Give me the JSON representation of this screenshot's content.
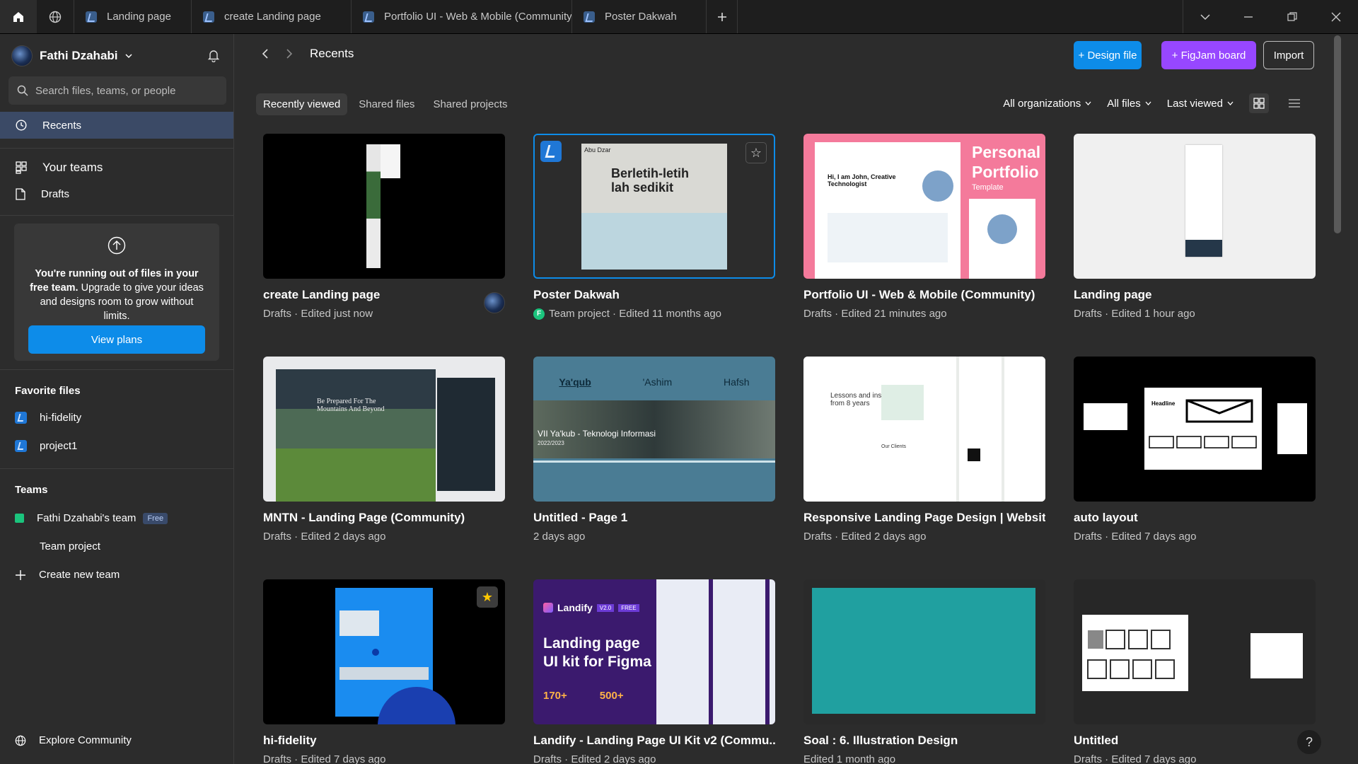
{
  "tabs": [
    {
      "label": "Landing page"
    },
    {
      "label": "create Landing page"
    },
    {
      "label": "Portfolio UI - Web & Mobile (Community)"
    },
    {
      "label": "Poster Dakwah"
    }
  ],
  "sidebar": {
    "user_name": "Fathi Dzahabi",
    "search_placeholder": "Search files, teams, or people",
    "recents": "Recents",
    "your_teams": "Your teams",
    "drafts": "Drafts",
    "upgrade_text_bold": "You're running out of files in your free team.",
    "upgrade_text_rest": " Upgrade to give your ideas and designs room to grow without limits.",
    "view_plans": "View plans",
    "favorites_title": "Favorite files",
    "favorites": [
      "hi-fidelity",
      "project1"
    ],
    "teams_title": "Teams",
    "team_name": "Fathi Dzahabi's team",
    "team_badge": "Free",
    "team_project": "Team project",
    "create_team": "Create new team",
    "explore": "Explore Community"
  },
  "header": {
    "title": "Recents",
    "design_file": "+ Design file",
    "figjam_board": "+ FigJam board",
    "import": "Import"
  },
  "filters": {
    "tabs": [
      "Recently viewed",
      "Shared files",
      "Shared projects"
    ],
    "org": "All organizations",
    "files": "All files",
    "sort": "Last viewed"
  },
  "colors": {
    "accent_blue": "#0d8ce9",
    "figjam_purple": "#9747ff",
    "team_green": "#1bc47d"
  },
  "files": [
    {
      "title": "create Landing page",
      "sub": "Drafts · Edited just now"
    },
    {
      "title": "Poster Dakwah",
      "sub": "Team project · Edited 11 months ago",
      "project_initial": "F"
    },
    {
      "title": "Portfolio UI - Web & Mobile (Community)",
      "sub": "Drafts · Edited 21 minutes ago"
    },
    {
      "title": "Landing page",
      "sub": "Drafts · Edited 1 hour ago"
    },
    {
      "title": "MNTN - Landing Page (Community)",
      "sub": "Drafts · Edited 2 days ago"
    },
    {
      "title": "Untitled - Page 1",
      "sub": "2 days ago"
    },
    {
      "title": "Responsive Landing Page Design | Websit...",
      "sub": "Drafts · Edited 2 days ago"
    },
    {
      "title": "auto layout",
      "sub": "Drafts · Edited 7 days ago"
    },
    {
      "title": "hi-fidelity",
      "sub": "Drafts · Edited 7 days ago"
    },
    {
      "title": "Landify - Landing Page UI Kit v2 (Commu...",
      "sub": "Drafts · Edited 2 days ago"
    },
    {
      "title": "Soal : 6. Illustration Design",
      "sub": "Edited 1 month ago"
    },
    {
      "title": "Untitled",
      "sub": "Drafts · Edited 7 days ago"
    }
  ],
  "thumbs": {
    "poster_l1": "Berletih-letih",
    "poster_l2": "lah sedikit",
    "poster_small": "Abu Dzar",
    "portfolio_h1": "Personal",
    "portfolio_h2": "Portfolio",
    "portfolio_sub": "Template",
    "portfolio_hi": "Hi, I am John, Creative Technologist",
    "mntn_text": "Be Prepared For The Mountains And Beyond",
    "yaqub_names": [
      "Ya'qub",
      "'Ashim",
      "Hafsh"
    ],
    "yaqub_caption": "VII Ya'kub - Teknologi Informasi",
    "yaqub_year": "2022/2023",
    "resp_text": "Lessons and insights from 8 years",
    "resp_clients": "Our Clients",
    "auto_headline": "Headline",
    "landify_brand": "Landify",
    "landify_ver": "V2.0",
    "landify_free": "FREE",
    "landify_h1": "Landing page",
    "landify_h2": "UI kit for Figma",
    "landify_n1": "170+",
    "landify_n2": "500+"
  }
}
